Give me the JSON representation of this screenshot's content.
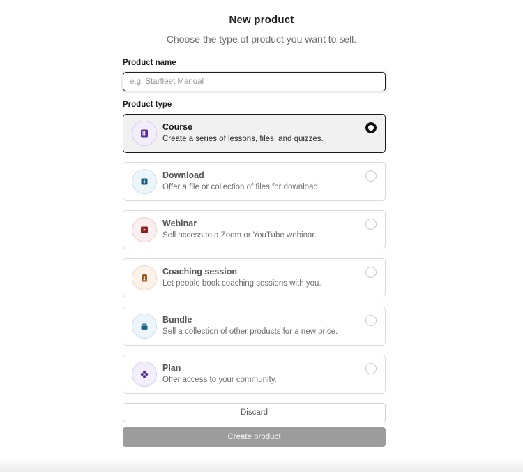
{
  "header": {
    "title": "New product",
    "subtitle": "Choose the type of product you want to sell."
  },
  "form": {
    "name_label": "Product name",
    "name_placeholder": "e.g. Starfleet Manual",
    "name_value": "",
    "type_label": "Product type"
  },
  "options": [
    {
      "title": "Course",
      "description": "Create a series of lessons, files, and quizzes.",
      "icon": "course-book-icon",
      "accent": "#5a2fa3",
      "tint": "#f3eefb",
      "selected": true
    },
    {
      "title": "Download",
      "description": "Offer a file or collection of files for download.",
      "icon": "download-icon",
      "accent": "#1c5f86",
      "tint": "#ecf5fa",
      "selected": false
    },
    {
      "title": "Webinar",
      "description": "Sell access to a Zoom or YouTube webinar.",
      "icon": "video-play-icon",
      "accent": "#8d1f1f",
      "tint": "#fbeeee",
      "selected": false
    },
    {
      "title": "Coaching session",
      "description": "Let people book coaching sessions with you.",
      "icon": "clipboard-person-icon",
      "accent": "#9a5a1c",
      "tint": "#fcf2ea",
      "selected": false
    },
    {
      "title": "Bundle",
      "description": "Sell a collection of other products for a new price.",
      "icon": "stack-icon",
      "accent": "#1c5f86",
      "tint": "#ecf5fa",
      "selected": false
    },
    {
      "title": "Plan",
      "description": "Offer access to your community.",
      "icon": "community-dots-icon",
      "accent": "#4a2a8f",
      "tint": "#f3eefb",
      "selected": false
    }
  ],
  "actions": {
    "discard_label": "Discard",
    "create_label": "Create product"
  }
}
